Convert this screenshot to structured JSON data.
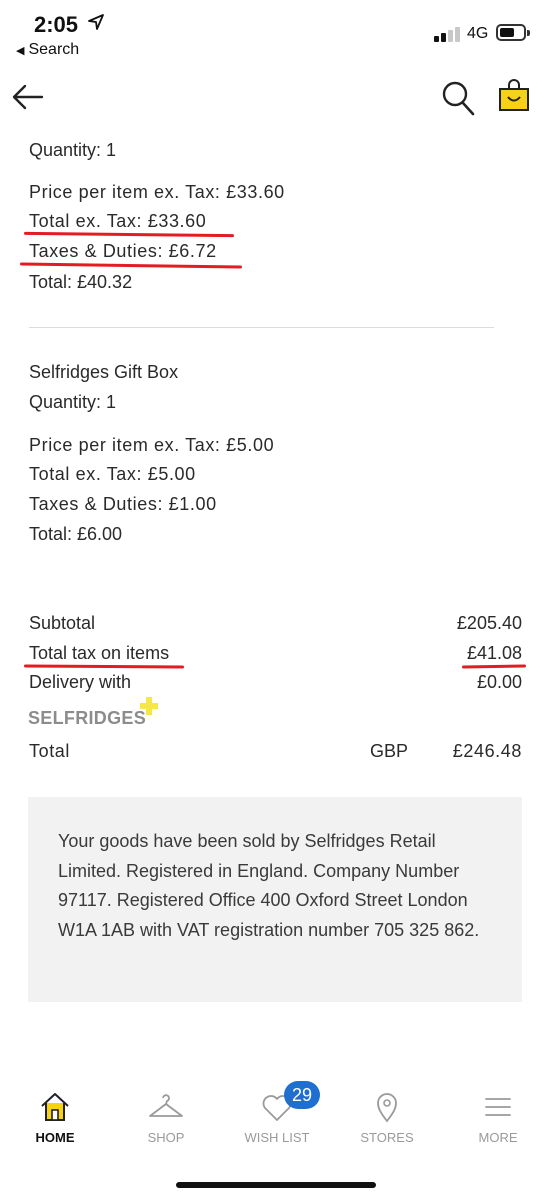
{
  "status_bar": {
    "time": "2:05",
    "back_label": "Search",
    "network": "4G"
  },
  "header": {
    "back_icon": "arrow-left-icon",
    "search_icon": "search-icon",
    "bag_icon": "shopping-bag-icon",
    "accent_color": "#f7d117"
  },
  "item1": {
    "quantity": "Quantity: 1",
    "price_per_item": "Price per item ex. Tax: £33.60",
    "total_ex_tax": "Total ex. Tax: £33.60",
    "taxes_duties": "Taxes & Duties: £6.72",
    "total": "Total: £40.32"
  },
  "item2": {
    "name": "Selfridges Gift Box",
    "quantity": "Quantity: 1",
    "price_per_item": "Price per item ex. Tax: £5.00",
    "total_ex_tax": "Total ex. Tax: £5.00",
    "taxes_duties": "Taxes & Duties: £1.00",
    "total": "Total: £6.00"
  },
  "summary": {
    "subtotal_label": "Subtotal",
    "subtotal_value": "£205.40",
    "tax_label": "Total tax on items",
    "tax_value": "£41.08",
    "delivery_label": "Delivery with",
    "delivery_value": "£0.00",
    "delivery_brand": "SELFRIDGES",
    "total_label": "Total",
    "currency": "GBP",
    "total_value": "£246.48"
  },
  "notice": "Your goods have been sold by Selfridges Retail Limited. Registered in England. Company Number 97117. Registered Office 400 Oxford Street London W1A 1AB with VAT registration number 705 325 862.",
  "annotation_color": "#e31b23",
  "tabs": [
    {
      "label": "HOME",
      "icon": "home-icon",
      "active": true
    },
    {
      "label": "SHOP",
      "icon": "hanger-icon",
      "active": false
    },
    {
      "label": "WISH LIST",
      "icon": "heart-icon",
      "active": false
    },
    {
      "label": "STORES",
      "icon": "location-pin-icon",
      "active": false
    },
    {
      "label": "MORE",
      "icon": "menu-icon",
      "active": false
    }
  ],
  "wishlist_count": "29"
}
